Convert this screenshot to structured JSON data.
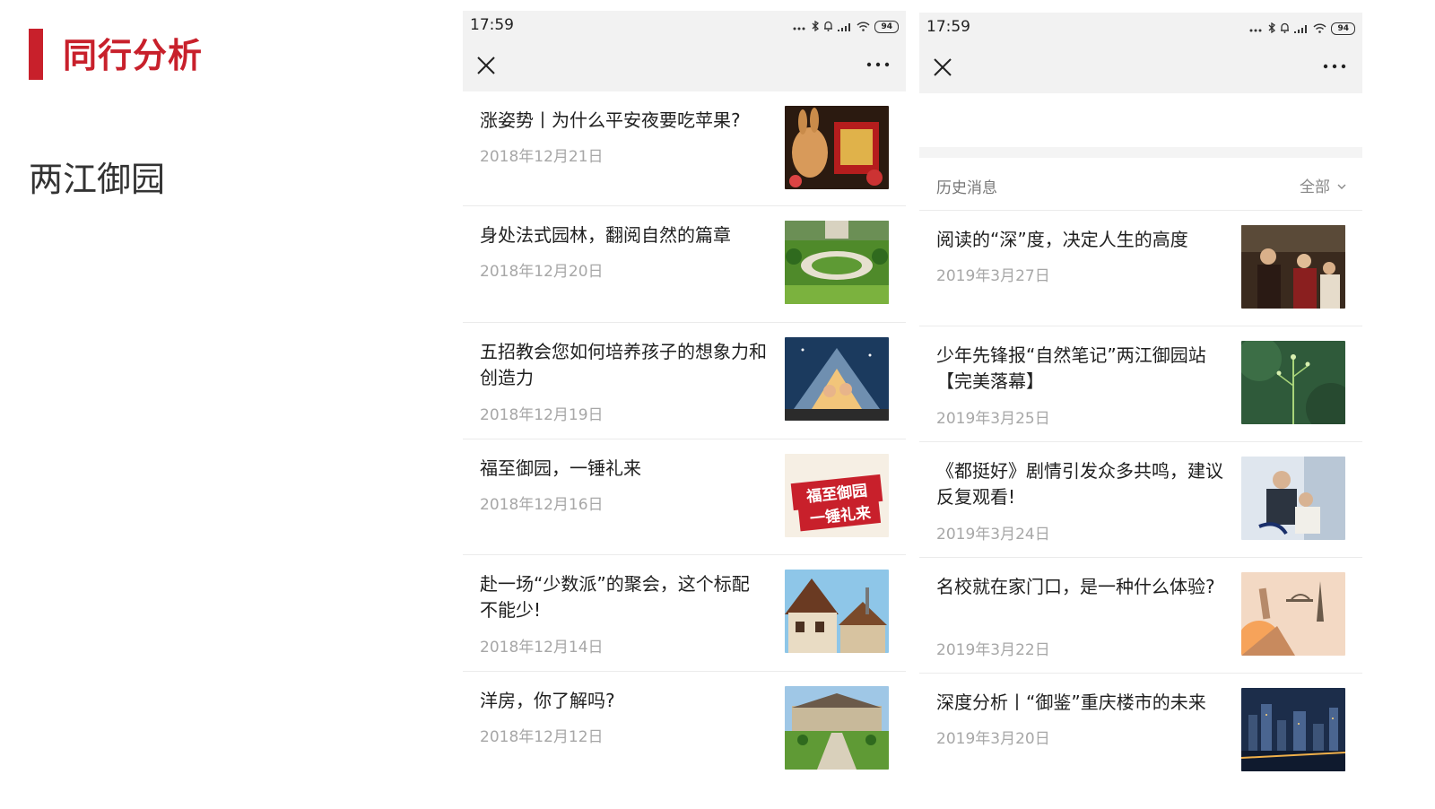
{
  "slide": {
    "title": "同行分析",
    "subject": "两江御园",
    "accent_color": "#c8202b"
  },
  "phone_left": {
    "status_time": "17:59",
    "battery": "94",
    "articles": [
      {
        "title": "涨姿势丨为什么平安夜要吃苹果?",
        "date": "2018年12月21日",
        "thumb": "rabbit-gift-image"
      },
      {
        "title": "身处法式园林，翻阅自然的篇章",
        "date": "2018年12月20日",
        "thumb": "garden-aerial-image"
      },
      {
        "title": "五招教会您如何培养孩子的想象力和创造力",
        "date": "2018年12月19日",
        "thumb": "tent-reading-image"
      },
      {
        "title": "福至御园，一锤礼来",
        "date": "2018年12月16日",
        "thumb": "promo-banner-image",
        "thumb_text_1": "福至御园",
        "thumb_text_2": "一锤礼来"
      },
      {
        "title": "赴一场“少数派”的聚会，这个标配不能少!",
        "date": "2018年12月14日",
        "thumb": "timber-house-image"
      },
      {
        "title": "洋房，你了解吗?",
        "date": "2018年12月12日",
        "thumb": "mansion-lawn-image"
      }
    ]
  },
  "phone_right": {
    "status_time": "17:59",
    "battery": "94",
    "history_label": "历史消息",
    "filter_label": "全部",
    "articles": [
      {
        "title": "阅读的“深”度，决定人生的高度",
        "date": "2019年3月27日",
        "thumb": "painting-image"
      },
      {
        "title": "少年先锋报“自然笔记”两江御园站【完美落幕】",
        "date": "2019年3月25日",
        "thumb": "plant-image"
      },
      {
        "title": "《都挺好》剧情引发众多共鸣，建议反复观看!",
        "date": "2019年3月24日",
        "thumb": "drama-poster-image"
      },
      {
        "title": "名校就在家门口，是一种什么体验?",
        "date": "2019年3月22日",
        "thumb": "landmarks-image"
      },
      {
        "title": "深度分析丨“御鉴”重庆楼市的未来",
        "date": "2019年3月20日",
        "thumb": "city-night-image"
      }
    ]
  }
}
